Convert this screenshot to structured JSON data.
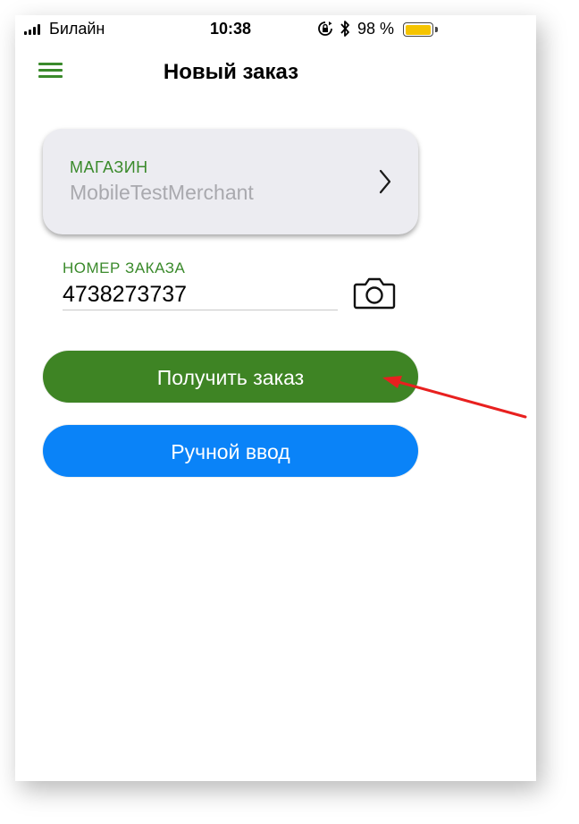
{
  "status_bar": {
    "carrier": "Билайн",
    "time": "10:38",
    "battery_percent": "98 %",
    "battery_level": 0.98,
    "battery_color": "#f5c400",
    "icons": [
      "signal-icon",
      "rotation-lock-icon",
      "bluetooth-icon",
      "battery-icon"
    ]
  },
  "header": {
    "title": "Новый заказ",
    "menu_icon": "hamburger-menu-icon"
  },
  "merchant": {
    "label": "МАГАЗИН",
    "value": "MobileTestMerchant",
    "chevron_icon": "chevron-right-icon"
  },
  "order": {
    "label": "НОМЕР ЗАКАЗА",
    "value": "4738273737",
    "camera_icon": "camera-icon"
  },
  "buttons": {
    "get_order_label": "Получить заказ",
    "manual_entry_label": "Ручной ввод"
  },
  "colors": {
    "accent_green": "#3e8424",
    "label_green": "#3a8a2b",
    "button_blue": "#0a83f8",
    "annotation_red": "#e8201f"
  }
}
